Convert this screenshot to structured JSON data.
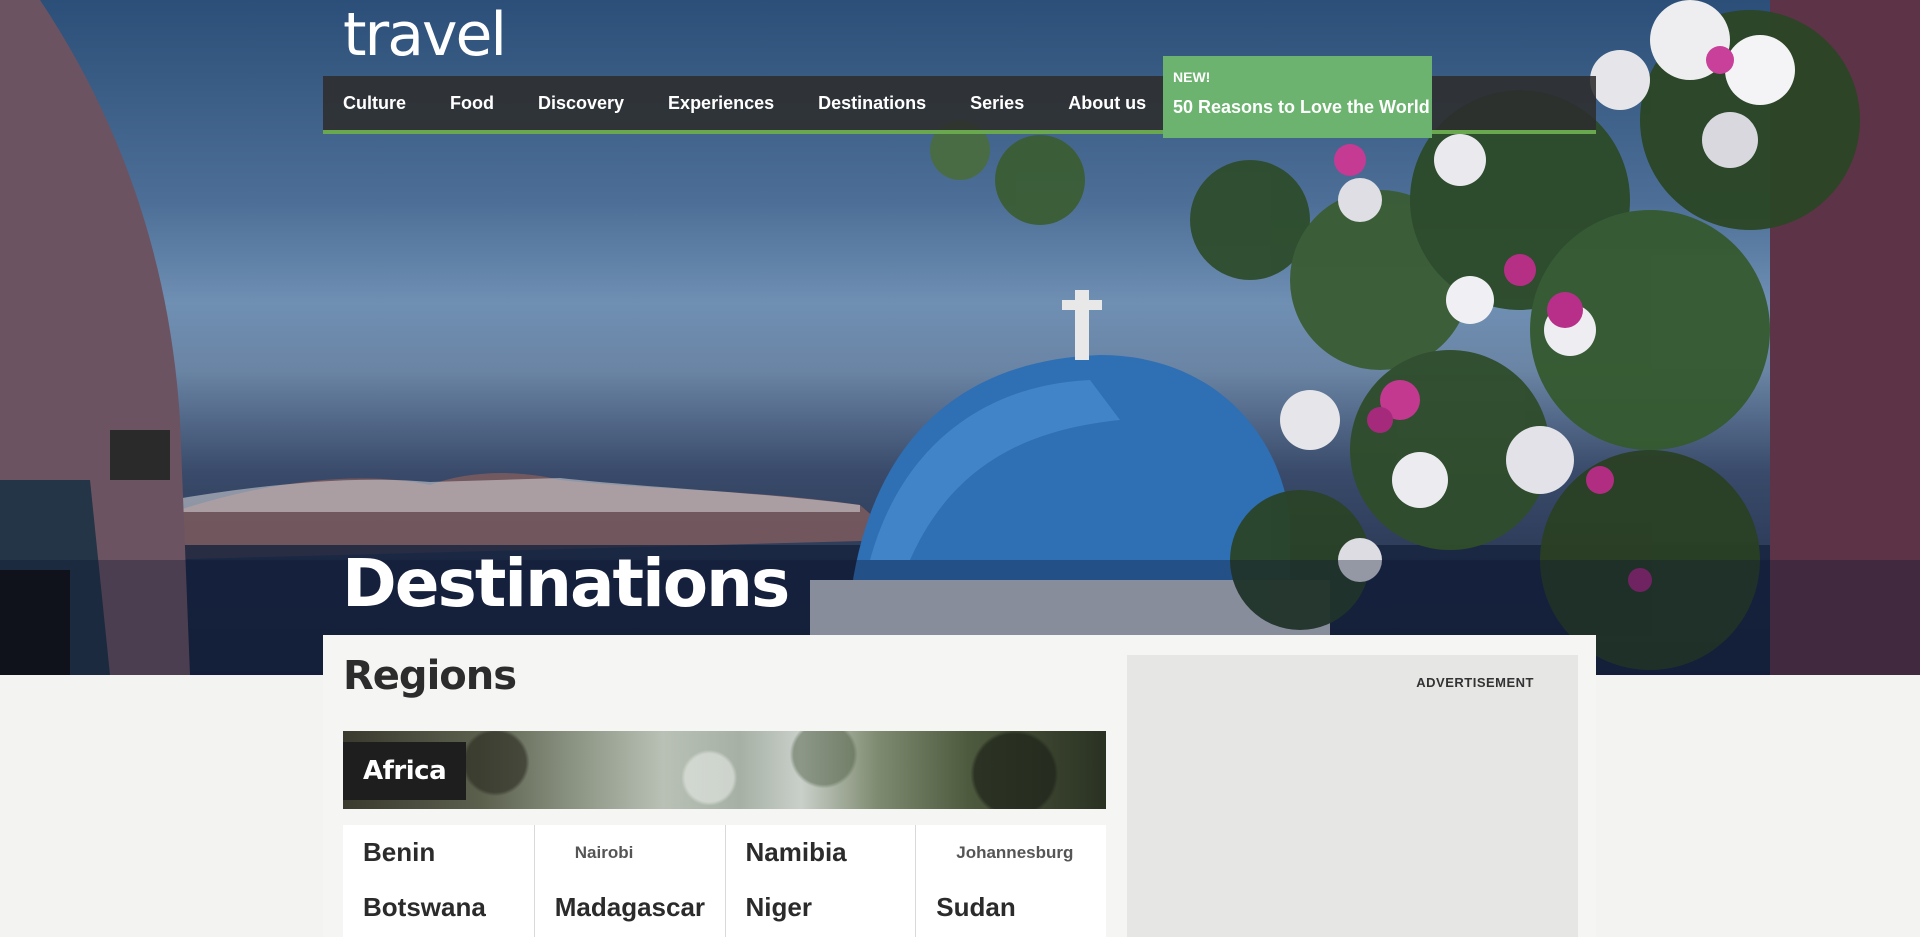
{
  "brand": {
    "logo_text": "travel"
  },
  "nav": {
    "items": [
      "Culture",
      "Food",
      "Discovery",
      "Experiences",
      "Destinations",
      "Series",
      "About us"
    ],
    "promo_badge": "NEW!",
    "promo_label": "50 Reasons to Love the World"
  },
  "hero": {
    "title": "Destinations"
  },
  "main": {
    "section_title": "Regions",
    "region": {
      "name": "Africa",
      "columns": [
        [
          {
            "type": "country",
            "label": "Benin"
          },
          {
            "type": "country",
            "label": "Botswana"
          }
        ],
        [
          {
            "type": "city",
            "label": "Nairobi"
          },
          {
            "type": "country",
            "label": "Madagascar"
          }
        ],
        [
          {
            "type": "country",
            "label": "Namibia"
          },
          {
            "type": "country",
            "label": "Niger"
          }
        ],
        [
          {
            "type": "city",
            "label": "Johannesburg"
          },
          {
            "type": "country",
            "label": "Sudan"
          }
        ]
      ]
    }
  },
  "ad": {
    "label": "ADVERTISEMENT"
  },
  "colors": {
    "accent_green": "#6bb36f",
    "nav_bg": "#2d2d2d",
    "page_bg": "#f3f3f1"
  }
}
